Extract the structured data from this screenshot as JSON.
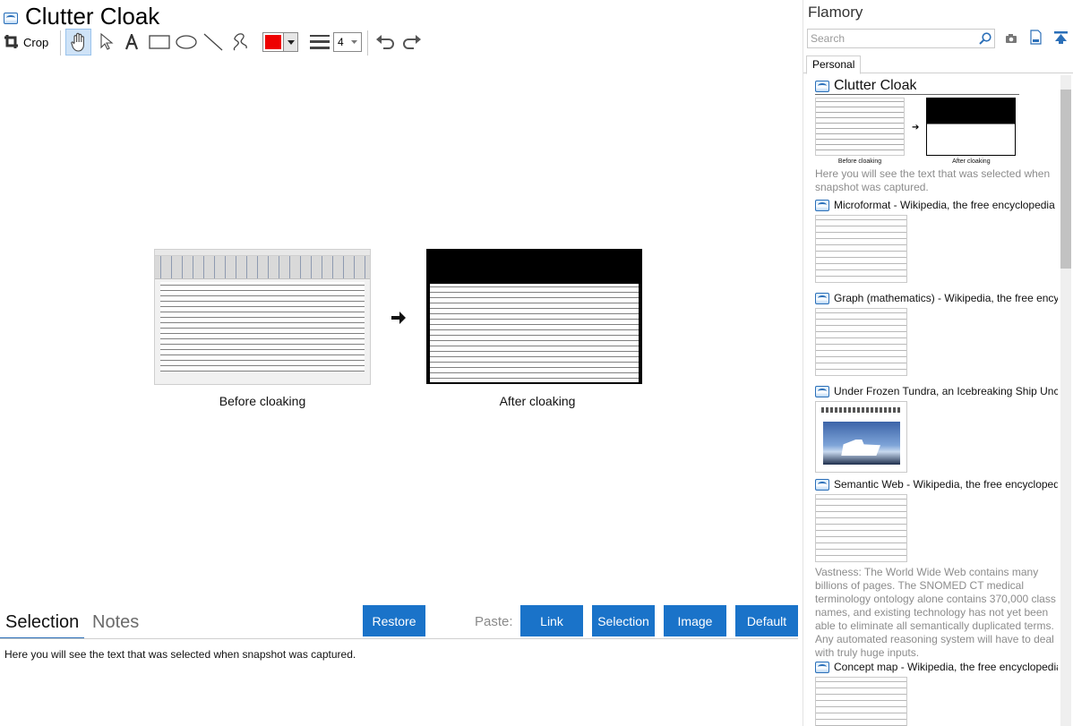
{
  "window": {
    "title": "Clutter Cloak"
  },
  "toolbar": {
    "crop_label": "Crop",
    "tools": [
      "hand-tool",
      "select-tool",
      "text-tool",
      "rectangle-tool",
      "ellipse-tool",
      "line-tool",
      "freehand-tool"
    ],
    "active_tool": "hand-tool",
    "color": "#ee0000",
    "line_width": "4"
  },
  "snapshot": {
    "before_caption": "Before cloaking",
    "after_caption": "After cloaking"
  },
  "bottom": {
    "tabs": [
      "Selection",
      "Notes"
    ],
    "active_tab": "Selection",
    "restore_label": "Restore",
    "paste_label": "Paste:",
    "paste_buttons": [
      "Link",
      "Selection",
      "Image",
      "Default"
    ],
    "selection_text": "Here you will see the text that was selected when snapshot was captured."
  },
  "sidebar": {
    "app_title": "Flamory",
    "search_placeholder": "Search",
    "tab": "Personal",
    "items": [
      {
        "title": "Clutter Cloak",
        "thumb_before": "Before cloaking",
        "thumb_after": "After cloaking",
        "desc_line1": "Here you will see the text that was selected when",
        "desc_line2": "snapshot was captured."
      },
      {
        "title": "Microformat - Wikipedia, the free encyclopedia"
      },
      {
        "title": "Graph (mathematics) - Wikipedia, the free ency"
      },
      {
        "title": "Under Frozen Tundra, an Icebreaking Ship Unco"
      },
      {
        "title": "Semantic Web - Wikipedia, the free encycloped",
        "desc_lines": [
          "Vastness: The World Wide Web contains many",
          "billions of pages. The SNOMED CT medical",
          "terminology ontology alone contains 370,000 class",
          "names, and existing technology has not yet been",
          "able to eliminate all semantically duplicated terms.",
          "Any automated reasoning system will have to deal",
          "with truly huge inputs."
        ]
      },
      {
        "title": "Concept map - Wikipedia, the free encyclopedia"
      }
    ]
  },
  "colors": {
    "accent": "#1a73c9",
    "active_tool_bg": "#cfe3f7"
  }
}
